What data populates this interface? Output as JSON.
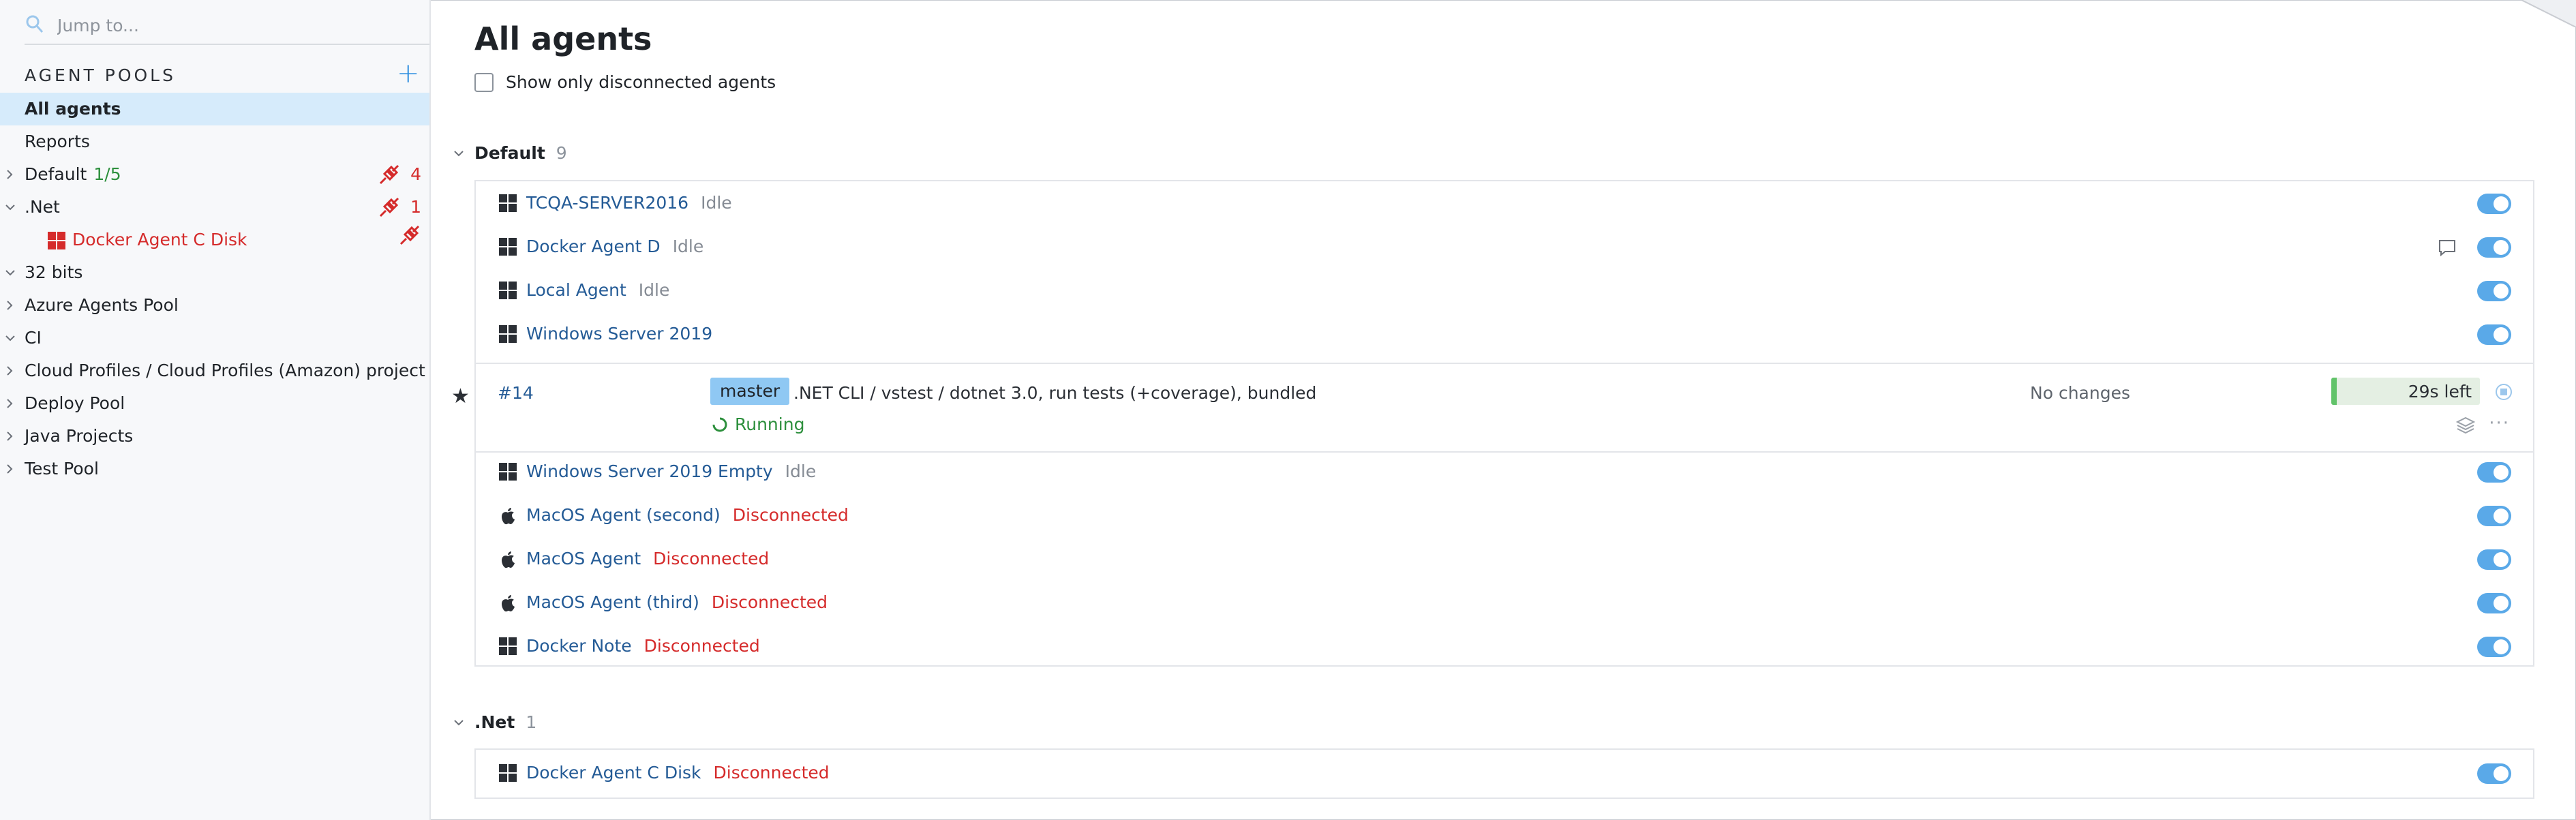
{
  "sidebar": {
    "search_placeholder": "Jump to...",
    "pools_heading": "AGENT POOLS",
    "add_label": "+",
    "items": [
      {
        "label": "All agents"
      },
      {
        "label": "Reports"
      },
      {
        "label": "Default",
        "count": "1/5",
        "disconnected": "4"
      },
      {
        "label": ".Net",
        "disconnected": "1"
      },
      {
        "label": "Docker Agent C Disk"
      },
      {
        "label": "32 bits"
      },
      {
        "label": "Azure Agents Pool"
      },
      {
        "label": "CI"
      },
      {
        "label": "Cloud Profiles / Cloud Profiles (Amazon) project"
      },
      {
        "label": "Deploy Pool"
      },
      {
        "label": "Java Projects"
      },
      {
        "label": "Test Pool"
      }
    ]
  },
  "main": {
    "title": "All agents",
    "filter_label": "Show only disconnected agents",
    "sections": [
      {
        "name": "Default",
        "count": "9",
        "agents": [
          {
            "name": "TCQA-SERVER2016",
            "status": "Idle"
          },
          {
            "name": "Docker Agent D",
            "status": "Idle"
          },
          {
            "name": "Local Agent",
            "status": "Idle"
          },
          {
            "name": "Windows Server 2019",
            "status": ""
          },
          {
            "name": "Windows Server 2019 Empty",
            "status": "Idle"
          },
          {
            "name": "MacOS Agent (second)",
            "status": "Disconnected"
          },
          {
            "name": "MacOS Agent",
            "status": "Disconnected"
          },
          {
            "name": "MacOS Agent (third)",
            "status": "Disconnected"
          },
          {
            "name": "Docker Note",
            "status": "Disconnected"
          }
        ],
        "build": {
          "number": "#14",
          "branch": "master",
          "config": ".NET CLI / vstest / dotnet 3.0, run tests (+coverage), bundled",
          "status": "Running",
          "changes": "No changes",
          "time_left": "29s left",
          "more": "···"
        }
      },
      {
        "name": ".Net",
        "count": "1",
        "agents": [
          {
            "name": "Docker Agent C Disk",
            "status": "Disconnected"
          }
        ]
      }
    ]
  },
  "colors": {
    "accent": "#2f8fe0",
    "link": "#245b96",
    "error": "#d52b2b",
    "success": "#2c8f3c",
    "toggle": "#5aa9e8",
    "selected": "#d6ebfb"
  }
}
